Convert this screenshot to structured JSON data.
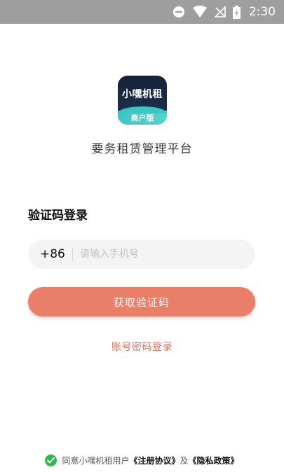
{
  "status_bar": {
    "time": "2:30"
  },
  "app": {
    "logo_title": "小嘿机租",
    "logo_subtitle": "商户版",
    "platform_name": "要务租赁管理平台"
  },
  "login": {
    "section_title": "验证码登录",
    "country_code": "+86",
    "phone_placeholder": "请输入手机号",
    "get_code_label": "获取验证码",
    "password_login_label": "账号密码登录"
  },
  "agreement": {
    "prefix": "同意小嘿机租用户",
    "register_link": "《注册协议》",
    "and": "及",
    "privacy_link": "《隐私政策》",
    "checked": true
  },
  "colors": {
    "accent": "#e97f68",
    "link": "#e0725c",
    "check": "#2fb84d"
  }
}
